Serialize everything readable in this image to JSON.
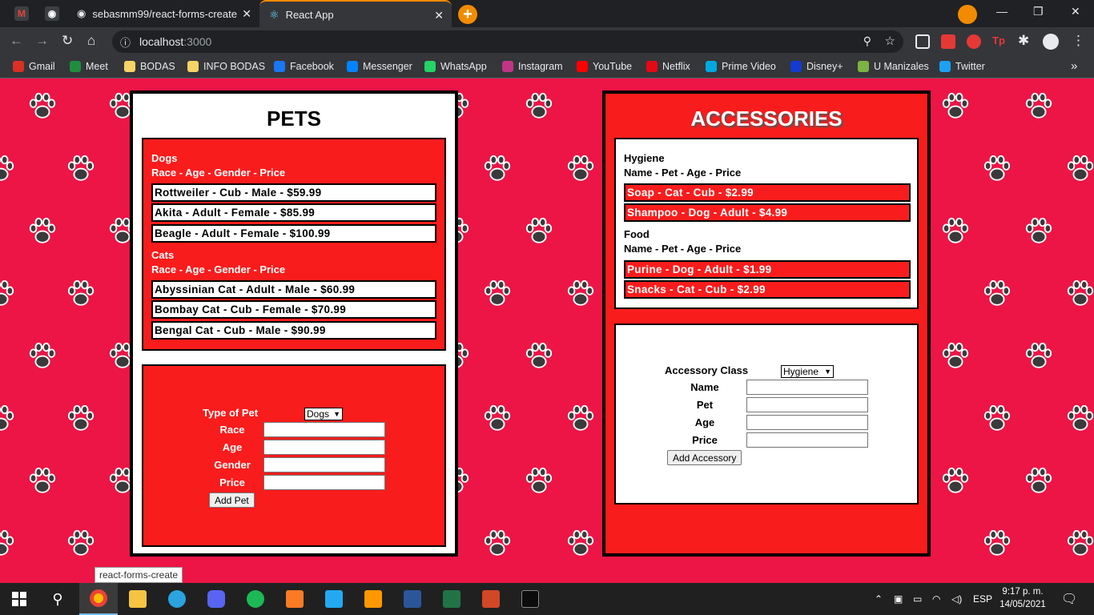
{
  "browser": {
    "tabs": [
      {
        "title": "sebasmm99/react-forms-create",
        "close": "✕"
      },
      {
        "title": "React App",
        "close": "✕"
      }
    ],
    "new_tab": "+",
    "window_controls": {
      "minimize": "—",
      "restore": "❐",
      "close": "✕"
    },
    "address": {
      "host": "localhost",
      "port": ":3000"
    },
    "bookmarks": [
      {
        "label": "Gmail",
        "color": "#d93025"
      },
      {
        "label": "Meet",
        "color": "#1e8e3e"
      },
      {
        "label": "BODAS",
        "color": "#f6d365"
      },
      {
        "label": "INFO BODAS",
        "color": "#f6d365"
      },
      {
        "label": "Facebook",
        "color": "#1877f2"
      },
      {
        "label": "Messenger",
        "color": "#0084ff"
      },
      {
        "label": "WhatsApp",
        "color": "#25d366"
      },
      {
        "label": "Instagram",
        "color": "#c13584"
      },
      {
        "label": "YouTube",
        "color": "#ff0000"
      },
      {
        "label": "Netflix",
        "color": "#e50914"
      },
      {
        "label": "Prime Video",
        "color": "#00a8e1"
      },
      {
        "label": "Disney+",
        "color": "#113ccf"
      },
      {
        "label": "U Manizales",
        "color": "#7cb342"
      },
      {
        "label": "Twitter",
        "color": "#1da1f2"
      }
    ],
    "bookmarks_overflow": "»",
    "tooltip": "react-forms-create"
  },
  "pets": {
    "title": "PETS",
    "groups": [
      {
        "name": "Dogs",
        "header": "Race - Age - Gender - Price",
        "items": [
          "Rottweiler - Cub - Male - $59.99",
          "Akita - Adult - Female - $85.99",
          "Beagle - Adult - Female - $100.99"
        ]
      },
      {
        "name": "Cats",
        "header": "Race - Age - Gender - Price",
        "items": [
          "Abyssinian Cat - Adult - Male - $60.99",
          "Bombay Cat - Cub - Female - $70.99",
          "Bengal Cat - Cub - Male - $90.99"
        ]
      }
    ],
    "form": {
      "type_label": "Type of Pet",
      "type_value": "Dogs",
      "race_label": "Race",
      "age_label": "Age",
      "gender_label": "Gender",
      "price_label": "Price",
      "race_value": "",
      "age_value": "",
      "gender_value": "",
      "price_value": "",
      "submit": "Add Pet"
    }
  },
  "accessories": {
    "title": "ACCESSORIES",
    "groups": [
      {
        "name": "Hygiene",
        "header": "Name - Pet - Age - Price",
        "items": [
          "Soap - Cat - Cub - $2.99",
          "Shampoo - Dog - Adult - $4.99"
        ]
      },
      {
        "name": "Food",
        "header": "Name - Pet - Age - Price",
        "items": [
          "Purine - Dog - Adult - $1.99",
          "Snacks - Cat - Cub - $2.99"
        ]
      }
    ],
    "form": {
      "class_label": "Accessory Class",
      "class_value": "Hygiene",
      "name_label": "Name",
      "pet_label": "Pet",
      "age_label": "Age",
      "price_label": "Price",
      "name_value": "",
      "pet_value": "",
      "age_value": "",
      "price_value": "",
      "submit": "Add Accessory"
    }
  },
  "taskbar": {
    "language": "ESP",
    "time": "9:17 p. m.",
    "date": "14/05/2021"
  },
  "colors": {
    "page_background": "#ec1546",
    "panel_red": "#f91c1c",
    "tab_accent": "#f28b00"
  }
}
